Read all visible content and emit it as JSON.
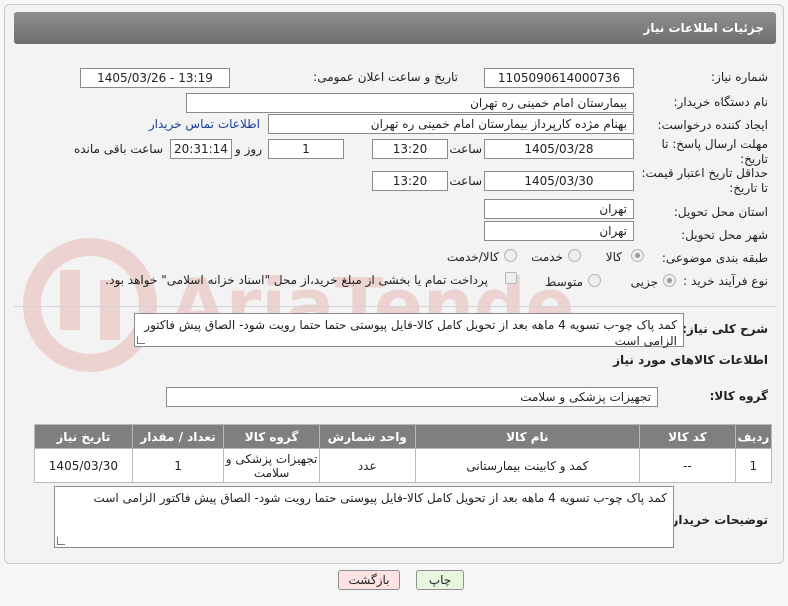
{
  "header": {
    "title": "جزئیات اطلاعات نیاز"
  },
  "need_number": {
    "label": "شماره نیاز:",
    "value": "1105090614000736"
  },
  "announce_date": {
    "label": "تاریخ و ساعت اعلان عمومی:",
    "value": "1405/03/26 - 13:19"
  },
  "buyer_org": {
    "label": "نام دستگاه خریدار:",
    "value": "بیمارستان امام خمینی ره  تهران"
  },
  "requester": {
    "label": "ایجاد کننده درخواست:",
    "value": "بهنام مژده کارپرداز بیمارستان امام خمینی ره  تهران",
    "contact_link": "اطلاعات تماس خریدار"
  },
  "reply_deadline": {
    "label_line1": "مهلت ارسال پاسخ: تا",
    "label_line2": "تاریخ:",
    "date": "1405/03/28",
    "time_label": "ساعت",
    "time": "13:20",
    "days": "1",
    "days_label": "روز و",
    "remaining": "20:31:14",
    "remaining_label": "ساعت باقی مانده"
  },
  "price_validity": {
    "label_line1": "حداقل تاریخ اعتبار قیمت:",
    "label_line2": "تا تاریخ:",
    "date": "1405/03/30",
    "time_label": "ساعت",
    "time": "13:20"
  },
  "delivery_province": {
    "label": "استان محل تحویل:",
    "value": "تهران"
  },
  "delivery_city": {
    "label": "شهر محل تحویل:",
    "value": "تهران"
  },
  "category": {
    "label": "طبقه بندی موضوعی:",
    "options": [
      "کالا",
      "خدمت",
      "کالا/خدمت"
    ],
    "selected": "کالا"
  },
  "purchase_process": {
    "label": "نوع فرآیند خرید :",
    "options": [
      "جزیی",
      "متوسط"
    ],
    "payment_note": "پرداخت تمام یا بخشی از مبلغ خرید،از محل \"اسناد خزانه اسلامی\" خواهد بود."
  },
  "summary": {
    "label": "شرح کلی نیاز:",
    "value": "کمد پاک چو-ب تسویه 4 ماهه بعد از تحویل کامل کالا-فایل پیوستی حتما حتما رویت شود- الصاق پیش فاکتور الزامی است"
  },
  "goods_section": {
    "title": "اطلاعات کالاهای مورد نیاز"
  },
  "goods_group": {
    "label": "گروه کالا:",
    "value": "تجهیزات پزشکی و سلامت"
  },
  "table": {
    "headers": [
      "ردیف",
      "کد کالا",
      "نام کالا",
      "واحد شمارش",
      "گروه کالا",
      "تعداد / مقدار",
      "تاریخ نیاز"
    ],
    "rows": [
      [
        "1",
        "--",
        "کمد و کابینت بیمارستانی",
        "عدد",
        "تجهیزات پزشکی و سلامت",
        "1",
        "1405/03/30"
      ]
    ]
  },
  "buyer_notes": {
    "label": "توضیحات خریدار:",
    "value": "کمد پاک چو-ب تسویه 4 ماهه بعد از تحویل کامل کالا-فایل پیوستی حتما رویت شود- الصاق پیش فاکتور الزامی است"
  },
  "buttons": {
    "print": "چاپ",
    "back": "بازگشت"
  },
  "colors": {
    "header": "#7f7f7f",
    "link": "#1a3d9c",
    "print_btn": "#e8f6de",
    "back_btn": "#fde3e3"
  },
  "watermark_text": "AriaTender.net"
}
